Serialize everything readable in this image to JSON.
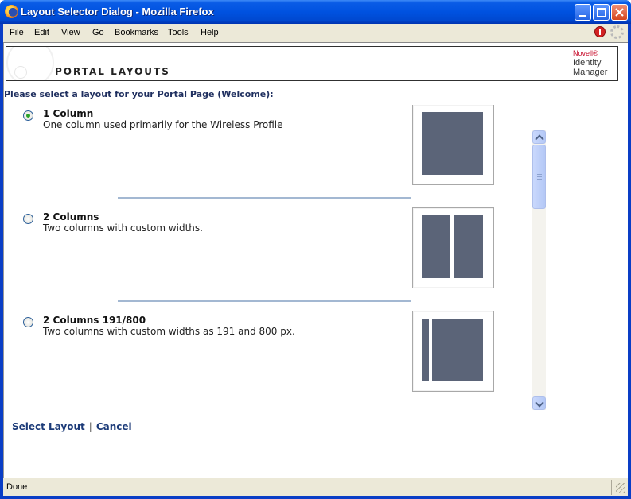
{
  "window": {
    "title": "Layout Selector Dialog - Mozilla Firefox",
    "icon": "firefox-icon"
  },
  "menu": {
    "items": [
      "File",
      "Edit",
      "View",
      "Go",
      "Bookmarks",
      "Tools",
      "Help"
    ]
  },
  "header": {
    "title": "PORTAL LAYOUTS",
    "brand_novell": "Novell®",
    "brand_product_line1": "Identity",
    "brand_product_line2": "Manager"
  },
  "prompt": "Please select a layout for your Portal Page (Welcome):",
  "layouts": [
    {
      "title": "1 Column",
      "description": "One column used primarily for the Wireless Profile",
      "selected": true
    },
    {
      "title": "2 Columns",
      "description": "Two columns with custom widths.",
      "selected": false
    },
    {
      "title": "2 Columns 191/800",
      "description": "Two columns with custom widths as 191 and 800 px.",
      "selected": false
    }
  ],
  "actions": {
    "select": "Select Layout",
    "separator": "|",
    "cancel": "Cancel"
  },
  "status": {
    "text": "Done"
  },
  "colors": {
    "accent": "#1b3a78",
    "thumbnail_block": "#5b6478",
    "separator": "#a3b8d2",
    "titlebar": "#0052e0"
  }
}
